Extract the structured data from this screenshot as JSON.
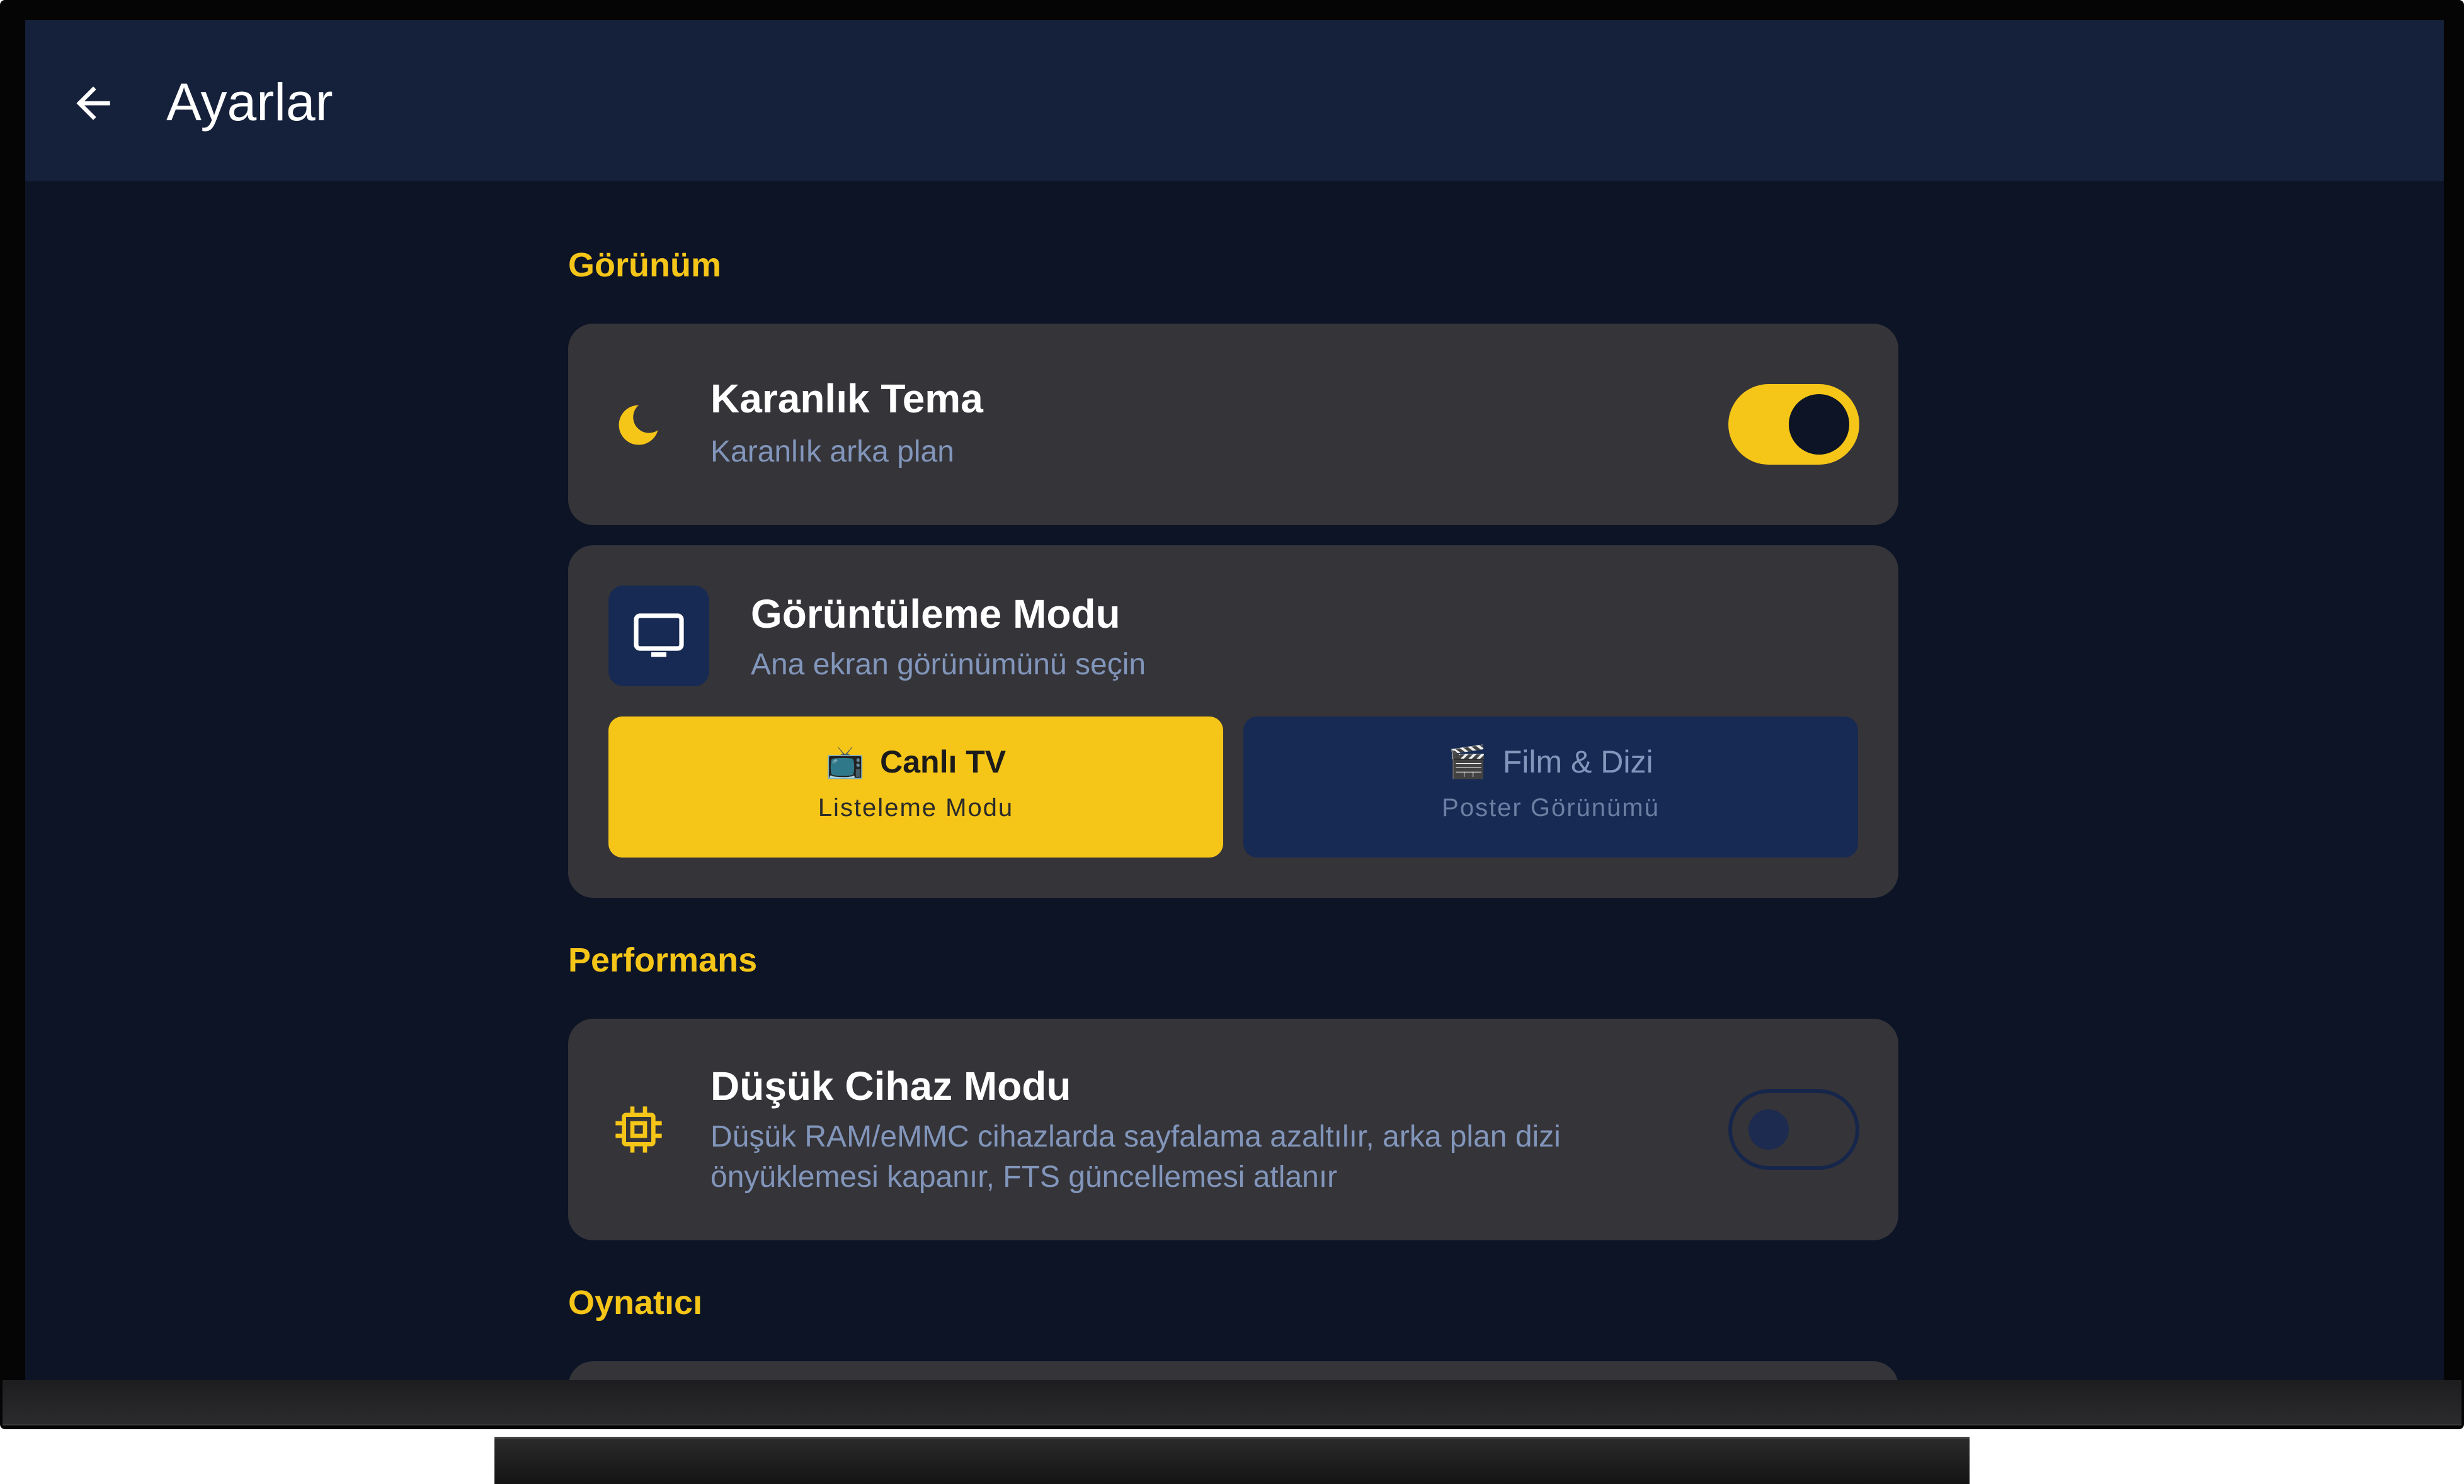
{
  "app_bar": {
    "title": "Ayarlar",
    "back_icon": "arrow-left-icon"
  },
  "sections": {
    "gorunum": "Görünüm",
    "performans": "Performans",
    "oynatici": "Oynatıcı"
  },
  "dark_theme": {
    "icon": "moon-icon",
    "title": "Karanlık Tema",
    "subtitle": "Karanlık arka plan",
    "enabled": true
  },
  "display_mode": {
    "icon": "monitor-icon",
    "title": "Görüntüleme Modu",
    "subtitle": "Ana ekran görünümünü seçin",
    "options": [
      {
        "emoji": "📺",
        "title": "Canlı TV",
        "subtitle": "Listeleme Modu",
        "selected": true
      },
      {
        "emoji": "🎬",
        "title": "Film & Dizi",
        "subtitle": "Poster Görünümü",
        "selected": false
      }
    ]
  },
  "low_device_mode": {
    "icon": "chip-icon",
    "title": "Düşük Cihaz Modu",
    "subtitle_line1": "Düşük RAM/eMMC cihazlarda sayfalama azaltılır, arka plan dizi",
    "subtitle_line2": "önyüklemesi kapanır, FTS güncellemesi atlanır",
    "enabled": false
  },
  "colors": {
    "background": "#0c1426",
    "app_bar": "#15203a",
    "card": "#353439",
    "accent": "#f5c518",
    "subtitle": "#8296bb",
    "unselected_button": "#172a53"
  }
}
